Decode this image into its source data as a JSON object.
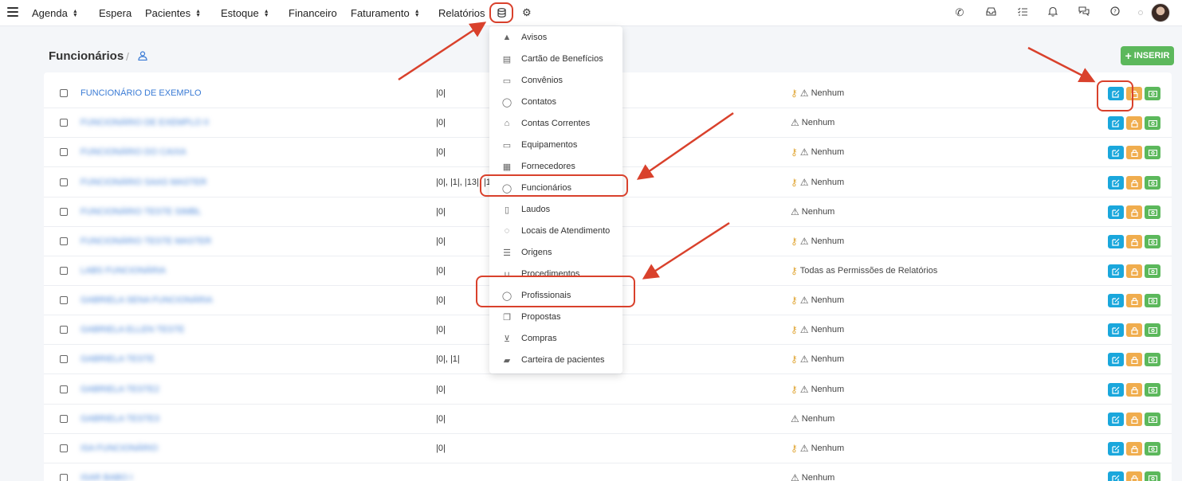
{
  "nav": {
    "items": [
      "Agenda",
      "Espera",
      "Pacientes",
      "Estoque",
      "Financeiro",
      "Faturamento",
      "Relatórios"
    ]
  },
  "header": {
    "title": "Funcionários",
    "slash": "/",
    "insert_label": "INSERIR"
  },
  "dropdown": {
    "items": [
      {
        "label": "Avisos",
        "icon": "warning-icon"
      },
      {
        "label": "Cartão de Benefícios",
        "icon": "card-icon"
      },
      {
        "label": "Convênios",
        "icon": "credit-card-icon"
      },
      {
        "label": "Contatos",
        "icon": "user-icon"
      },
      {
        "label": "Contas Correntes",
        "icon": "bank-icon"
      },
      {
        "label": "Equipamentos",
        "icon": "laptop-icon"
      },
      {
        "label": "Fornecedores",
        "icon": "archive-icon"
      },
      {
        "label": "Funcionários",
        "icon": "user-icon"
      },
      {
        "label": "Laudos",
        "icon": "document-icon"
      },
      {
        "label": "Locais de Atendimento",
        "icon": "map-pin-icon"
      },
      {
        "label": "Origens",
        "icon": "list-icon"
      },
      {
        "label": "Procedimentos",
        "icon": "stethoscope-icon"
      },
      {
        "label": "Profissionais",
        "icon": "doctor-icon"
      },
      {
        "label": "Propostas",
        "icon": "copy-icon"
      },
      {
        "label": "Compras",
        "icon": "cart-icon"
      },
      {
        "label": "Carteira de pacientes",
        "icon": "wallet-icon"
      }
    ]
  },
  "rows": [
    {
      "name": "FUNCIONÁRIO DE EXEMPLO",
      "idx": "|0|",
      "key": true,
      "perm": "Nenhum"
    },
    {
      "name": "FUNCIONÁRIO DE EXEMPLO II",
      "idx": "|0|",
      "key": false,
      "perm": "Nenhum"
    },
    {
      "name": "FUNCIONÁRIO DO CAIXA",
      "idx": "|0|",
      "key": true,
      "perm": "Nenhum"
    },
    {
      "name": "FUNCIONÁRIO SAAS MASTER",
      "idx": "|0|, |1|, |13|, |1",
      "key": true,
      "perm": "Nenhum"
    },
    {
      "name": "FUNCIONÁRIO TESTE SIMBL",
      "idx": "|0|",
      "key": false,
      "perm": "Nenhum"
    },
    {
      "name": "FUNCIONÁRIO TESTE MASTER",
      "idx": "|0|",
      "key": true,
      "perm": "Nenhum"
    },
    {
      "name": "LABS FUNCIONÁRIA",
      "idx": "|0|",
      "key": true,
      "perm": "Todas as Permissões de Relatórios"
    },
    {
      "name": "GABRIELA SENA FUNCIONÁRIA",
      "idx": "|0|",
      "key": true,
      "perm": "Nenhum"
    },
    {
      "name": "GABRIELA ELLEN TESTE",
      "idx": "|0|",
      "key": true,
      "perm": "Nenhum"
    },
    {
      "name": "GABRIELA TESTE",
      "idx": "|0|, |1|",
      "key": true,
      "perm": "Nenhum"
    },
    {
      "name": "GABRIELA TESTE2",
      "idx": "|0|",
      "key": true,
      "perm": "Nenhum"
    },
    {
      "name": "GABRIELA TESTE3",
      "idx": "|0|",
      "key": false,
      "perm": "Nenhum"
    },
    {
      "name": "ISA FUNCIONÁRIO",
      "idx": "|0|",
      "key": true,
      "perm": "Nenhum"
    },
    {
      "name": "ISAR BABO I",
      "idx": "",
      "key": false,
      "perm": "Nenhum"
    }
  ],
  "colors": {
    "accent_red": "#d9412c",
    "link_blue": "#3a7bd5",
    "edit_blue": "#1aa7dc",
    "lock_orange": "#f0ad4e",
    "money_green": "#5cb85c"
  }
}
